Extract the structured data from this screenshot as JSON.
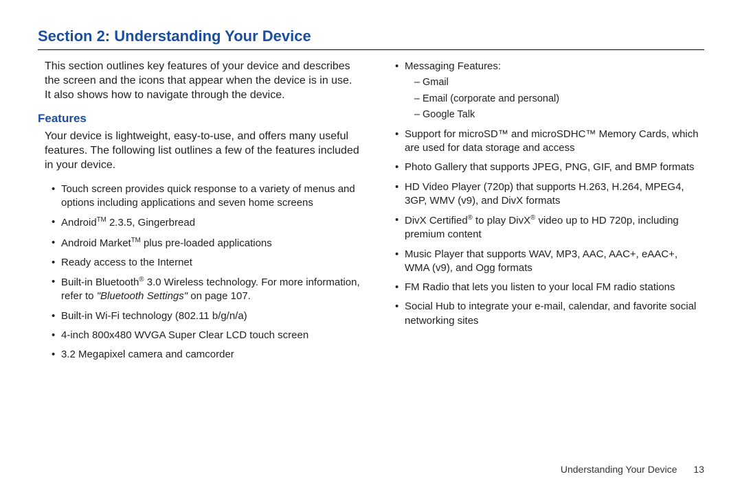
{
  "section_title": "Section 2: Understanding Your Device",
  "intro": "This section outlines key features of your device and describes the screen and the icons that appear when the device is in use. It also shows how to navigate through the device.",
  "features_heading": "Features",
  "features_intro": "Your device is lightweight, easy-to-use, and offers many useful features. The following list outlines a few of the features included in your device.",
  "col1_bullets": {
    "b1": "Touch screen provides quick response to a variety of menus and options including applications and seven home screens",
    "b2_pre": "Android",
    "b2_sup": "TM",
    "b2_post": " 2.3.5, Gingerbread",
    "b3_pre": "Android Market",
    "b3_sup": "TM",
    "b3_post": " plus pre-loaded applications",
    "b4": "Ready access to the Internet",
    "b5_pre": "Built-in Bluetooth",
    "b5_sup": "®",
    "b5_mid": " 3.0 Wireless technology. For more information, refer to ",
    "b5_ital": "\"Bluetooth Settings\"",
    "b5_post": "  on page 107.",
    "b6": "Built-in Wi-Fi technology (802.11 b/g/n/a)",
    "b7": "4-inch 800x480 WVGA Super Clear LCD touch screen",
    "b8": "3.2 Megapixel camera and camcorder"
  },
  "col2_bullets": {
    "msg_label": "Messaging Features:",
    "msg_sub1": "Gmail",
    "msg_sub2": "Email (corporate and personal)",
    "msg_sub3": "Google Talk",
    "b2": "Support for microSD™ and microSDHC™ Memory Cards, which are used for data storage and access",
    "b3": "Photo Gallery that supports JPEG, PNG, GIF, and BMP formats",
    "b4": "HD Video Player (720p) that supports H.263, H.264, MPEG4, 3GP, WMV (v9), and DivX formats",
    "b5_pre": "DivX Certified",
    "b5_sup1": "®",
    "b5_mid": " to play DivX",
    "b5_sup2": "®",
    "b5_post": " video up to HD 720p, including premium content",
    "b6": "Music Player that supports WAV, MP3, AAC, AAC+, eAAC+, WMA (v9), and Ogg formats",
    "b7": "FM Radio that lets you listen to your local FM radio stations",
    "b8": "Social Hub to integrate your e-mail, calendar, and favorite social networking sites"
  },
  "footer_text": "Understanding Your Device",
  "footer_page": "13"
}
